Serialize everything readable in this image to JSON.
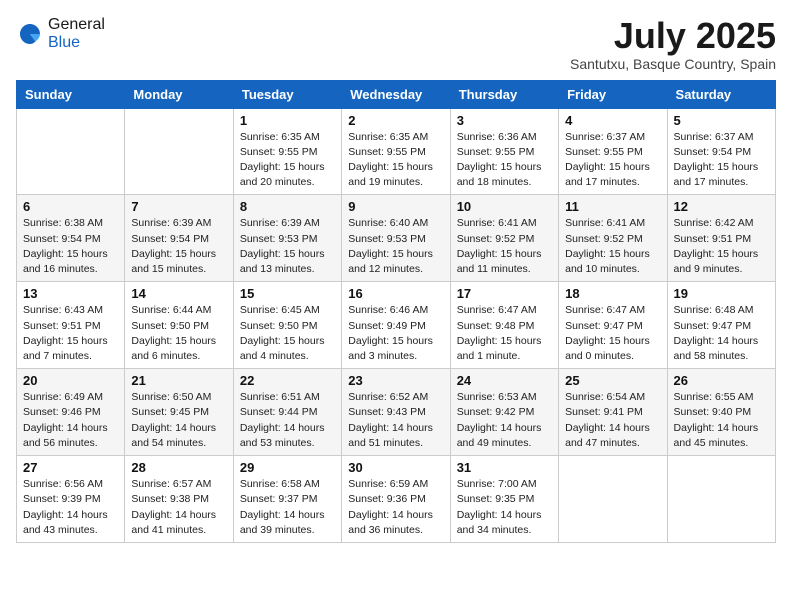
{
  "logo": {
    "general": "General",
    "blue": "Blue"
  },
  "title": "July 2025",
  "location": "Santutxu, Basque Country, Spain",
  "weekdays": [
    "Sunday",
    "Monday",
    "Tuesday",
    "Wednesday",
    "Thursday",
    "Friday",
    "Saturday"
  ],
  "weeks": [
    [
      {
        "day": "",
        "info": ""
      },
      {
        "day": "",
        "info": ""
      },
      {
        "day": "1",
        "info": "Sunrise: 6:35 AM\nSunset: 9:55 PM\nDaylight: 15 hours\nand 20 minutes."
      },
      {
        "day": "2",
        "info": "Sunrise: 6:35 AM\nSunset: 9:55 PM\nDaylight: 15 hours\nand 19 minutes."
      },
      {
        "day": "3",
        "info": "Sunrise: 6:36 AM\nSunset: 9:55 PM\nDaylight: 15 hours\nand 18 minutes."
      },
      {
        "day": "4",
        "info": "Sunrise: 6:37 AM\nSunset: 9:55 PM\nDaylight: 15 hours\nand 17 minutes."
      },
      {
        "day": "5",
        "info": "Sunrise: 6:37 AM\nSunset: 9:54 PM\nDaylight: 15 hours\nand 17 minutes."
      }
    ],
    [
      {
        "day": "6",
        "info": "Sunrise: 6:38 AM\nSunset: 9:54 PM\nDaylight: 15 hours\nand 16 minutes."
      },
      {
        "day": "7",
        "info": "Sunrise: 6:39 AM\nSunset: 9:54 PM\nDaylight: 15 hours\nand 15 minutes."
      },
      {
        "day": "8",
        "info": "Sunrise: 6:39 AM\nSunset: 9:53 PM\nDaylight: 15 hours\nand 13 minutes."
      },
      {
        "day": "9",
        "info": "Sunrise: 6:40 AM\nSunset: 9:53 PM\nDaylight: 15 hours\nand 12 minutes."
      },
      {
        "day": "10",
        "info": "Sunrise: 6:41 AM\nSunset: 9:52 PM\nDaylight: 15 hours\nand 11 minutes."
      },
      {
        "day": "11",
        "info": "Sunrise: 6:41 AM\nSunset: 9:52 PM\nDaylight: 15 hours\nand 10 minutes."
      },
      {
        "day": "12",
        "info": "Sunrise: 6:42 AM\nSunset: 9:51 PM\nDaylight: 15 hours\nand 9 minutes."
      }
    ],
    [
      {
        "day": "13",
        "info": "Sunrise: 6:43 AM\nSunset: 9:51 PM\nDaylight: 15 hours\nand 7 minutes."
      },
      {
        "day": "14",
        "info": "Sunrise: 6:44 AM\nSunset: 9:50 PM\nDaylight: 15 hours\nand 6 minutes."
      },
      {
        "day": "15",
        "info": "Sunrise: 6:45 AM\nSunset: 9:50 PM\nDaylight: 15 hours\nand 4 minutes."
      },
      {
        "day": "16",
        "info": "Sunrise: 6:46 AM\nSunset: 9:49 PM\nDaylight: 15 hours\nand 3 minutes."
      },
      {
        "day": "17",
        "info": "Sunrise: 6:47 AM\nSunset: 9:48 PM\nDaylight: 15 hours\nand 1 minute."
      },
      {
        "day": "18",
        "info": "Sunrise: 6:47 AM\nSunset: 9:47 PM\nDaylight: 15 hours\nand 0 minutes."
      },
      {
        "day": "19",
        "info": "Sunrise: 6:48 AM\nSunset: 9:47 PM\nDaylight: 14 hours\nand 58 minutes."
      }
    ],
    [
      {
        "day": "20",
        "info": "Sunrise: 6:49 AM\nSunset: 9:46 PM\nDaylight: 14 hours\nand 56 minutes."
      },
      {
        "day": "21",
        "info": "Sunrise: 6:50 AM\nSunset: 9:45 PM\nDaylight: 14 hours\nand 54 minutes."
      },
      {
        "day": "22",
        "info": "Sunrise: 6:51 AM\nSunset: 9:44 PM\nDaylight: 14 hours\nand 53 minutes."
      },
      {
        "day": "23",
        "info": "Sunrise: 6:52 AM\nSunset: 9:43 PM\nDaylight: 14 hours\nand 51 minutes."
      },
      {
        "day": "24",
        "info": "Sunrise: 6:53 AM\nSunset: 9:42 PM\nDaylight: 14 hours\nand 49 minutes."
      },
      {
        "day": "25",
        "info": "Sunrise: 6:54 AM\nSunset: 9:41 PM\nDaylight: 14 hours\nand 47 minutes."
      },
      {
        "day": "26",
        "info": "Sunrise: 6:55 AM\nSunset: 9:40 PM\nDaylight: 14 hours\nand 45 minutes."
      }
    ],
    [
      {
        "day": "27",
        "info": "Sunrise: 6:56 AM\nSunset: 9:39 PM\nDaylight: 14 hours\nand 43 minutes."
      },
      {
        "day": "28",
        "info": "Sunrise: 6:57 AM\nSunset: 9:38 PM\nDaylight: 14 hours\nand 41 minutes."
      },
      {
        "day": "29",
        "info": "Sunrise: 6:58 AM\nSunset: 9:37 PM\nDaylight: 14 hours\nand 39 minutes."
      },
      {
        "day": "30",
        "info": "Sunrise: 6:59 AM\nSunset: 9:36 PM\nDaylight: 14 hours\nand 36 minutes."
      },
      {
        "day": "31",
        "info": "Sunrise: 7:00 AM\nSunset: 9:35 PM\nDaylight: 14 hours\nand 34 minutes."
      },
      {
        "day": "",
        "info": ""
      },
      {
        "day": "",
        "info": ""
      }
    ]
  ]
}
